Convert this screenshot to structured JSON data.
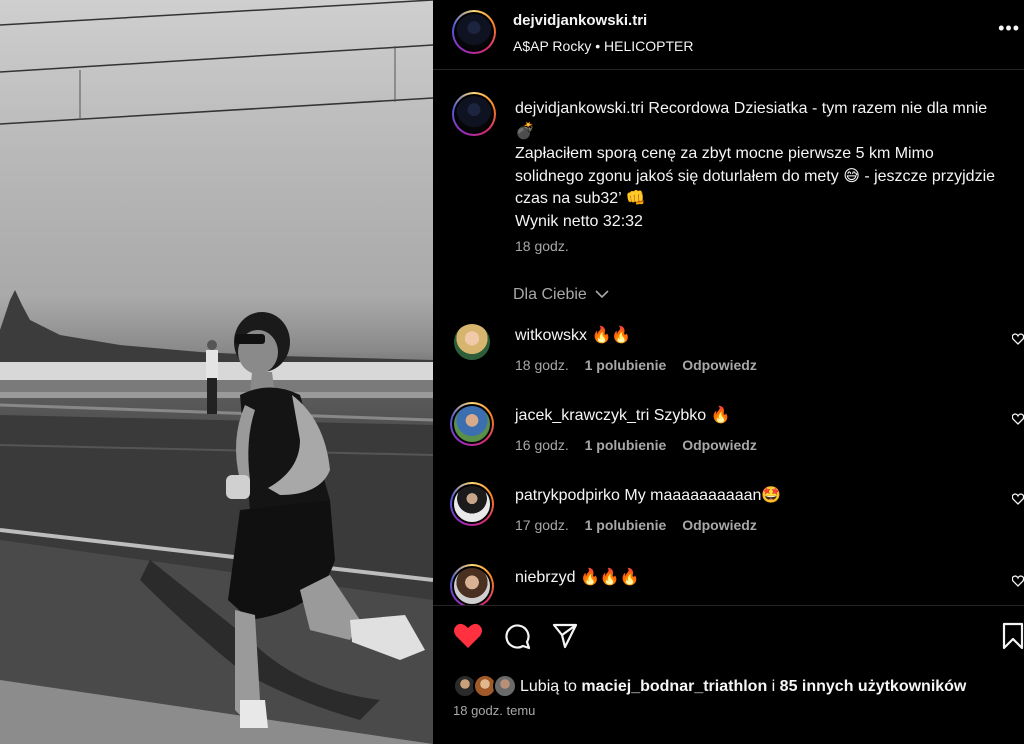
{
  "header": {
    "username": "dejvidjankowski.tri",
    "music": "A$AP Rocky • HELICOPTER",
    "more": "•••"
  },
  "caption": {
    "username": "dejvidjankowski.tri",
    "line1": "Recordowa Dziesiatka - tym razem nie dla mnie 💣",
    "line2": "Zapłaciłem sporą cenę za zbyt mocne pierwsze 5 km Mimo solidnego zgonu jakoś się doturlałem do mety 😅 - jeszcze przyjdzie czas na sub32’ 👊",
    "line3": "Wynik netto 32:32",
    "time": "18 godz."
  },
  "for_you": "Dla Ciebie",
  "comments": [
    {
      "user": "witkowskx",
      "text": "🔥🔥",
      "time": "18 godz.",
      "likes": "1 polubienie",
      "reply": "Odpowiedz"
    },
    {
      "user": "jacek_krawczyk_tri",
      "text": "Szybko 🔥",
      "time": "16 godz.",
      "likes": "1 polubienie",
      "reply": "Odpowiedz"
    },
    {
      "user": "patrykpodpirko",
      "text": "My maaaaaaaaaan🤩",
      "time": "17 godz.",
      "likes": "1 polubienie",
      "reply": "Odpowiedz"
    },
    {
      "user": "niebrzyd",
      "text": "🔥🔥🔥",
      "time": "",
      "likes": "",
      "reply": ""
    }
  ],
  "likes": {
    "prefix": "Lubią to ",
    "user": "maciej_bodnar_triathlon",
    "middle": " i ",
    "others": "85 innych użytkowników"
  },
  "post_time": "18 godz. temu",
  "colors": {
    "heart": "#ff3040",
    "muted": "#a8a8a8",
    "background": "#000000"
  }
}
